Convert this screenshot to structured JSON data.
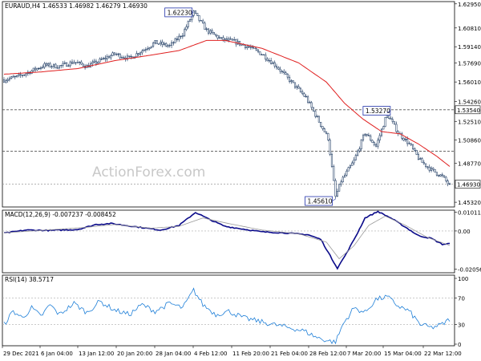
{
  "chart_data": [
    {
      "type": "candlestick",
      "title": "EURAUD,H4",
      "ohlc_label": "1.46533 1.46982 1.46279 1.46930",
      "last_price": "1.46930",
      "watermark": "ActionForex.com",
      "ylim": [
        1.449,
        1.6315
      ],
      "yticks": [
        "1.62950",
        "1.60810",
        "1.59140",
        "1.57690",
        "1.56010",
        "1.54260",
        "1.53540",
        "1.52510",
        "1.50860",
        "1.48770",
        "1.46930",
        "1.45320"
      ],
      "h_levels": [
        "1.53540",
        "1.49860"
      ],
      "annotations": [
        {
          "label": "1.62230",
          "price": 1.6223
        },
        {
          "label": "1.53270",
          "price": 1.5327
        },
        {
          "label": "1.45610",
          "price": 1.4561
        }
      ],
      "close_anchors": [
        [
          0,
          1.562
        ],
        [
          8,
          1.565
        ],
        [
          15,
          1.57
        ],
        [
          22,
          1.575
        ],
        [
          30,
          1.574
        ],
        [
          38,
          1.578
        ],
        [
          45,
          1.574
        ],
        [
          52,
          1.579
        ],
        [
          60,
          1.585
        ],
        [
          68,
          1.581
        ],
        [
          75,
          1.588
        ],
        [
          82,
          1.595
        ],
        [
          90,
          1.592
        ],
        [
          97,
          1.603
        ],
        [
          103,
          1.622
        ],
        [
          110,
          1.606
        ],
        [
          118,
          1.598
        ],
        [
          125,
          1.596
        ],
        [
          133,
          1.591
        ],
        [
          140,
          1.585
        ],
        [
          148,
          1.574
        ],
        [
          156,
          1.56
        ],
        [
          164,
          1.546
        ],
        [
          170,
          1.528
        ],
        [
          176,
          1.51
        ],
        [
          180,
          1.458
        ],
        [
          183,
          1.472
        ],
        [
          190,
          1.49
        ],
        [
          196,
          1.515
        ],
        [
          202,
          1.503
        ],
        [
          208,
          1.532
        ],
        [
          214,
          1.515
        ],
        [
          220,
          1.505
        ],
        [
          226,
          1.49
        ],
        [
          232,
          1.482
        ],
        [
          238,
          1.476
        ],
        [
          242,
          1.468
        ]
      ],
      "ma_anchors": [
        [
          0,
          1.567
        ],
        [
          20,
          1.569
        ],
        [
          40,
          1.572
        ],
        [
          60,
          1.579
        ],
        [
          80,
          1.584
        ],
        [
          95,
          1.588
        ],
        [
          110,
          1.597
        ],
        [
          120,
          1.597
        ],
        [
          140,
          1.59
        ],
        [
          160,
          1.577
        ],
        [
          175,
          1.56
        ],
        [
          185,
          1.541
        ],
        [
          195,
          1.527
        ],
        [
          205,
          1.516
        ],
        [
          215,
          1.514
        ],
        [
          225,
          1.505
        ],
        [
          235,
          1.494
        ],
        [
          242,
          1.485
        ]
      ]
    },
    {
      "type": "line",
      "title": "MACD(12,26,9) -0.007237 -0.008452",
      "ylim": [
        -0.0225,
        0.0112
      ],
      "yticks": [
        "0.010113",
        "0.00",
        "-0.020561"
      ],
      "series": [
        {
          "name": "MACD",
          "color": "#0b0b8a",
          "anchors": [
            [
              0,
              -0.0012
            ],
            [
              12,
              0.0005
            ],
            [
              25,
              0.0003
            ],
            [
              40,
              0.0008
            ],
            [
              50,
              0.0035
            ],
            [
              58,
              0.004
            ],
            [
              70,
              0.0025
            ],
            [
              85,
              0.0005
            ],
            [
              95,
              0.003
            ],
            [
              104,
              0.01
            ],
            [
              112,
              0.006
            ],
            [
              120,
              0.0025
            ],
            [
              130,
              0.001
            ],
            [
              140,
              -0.0005
            ],
            [
              152,
              -0.001
            ],
            [
              165,
              -0.002
            ],
            [
              172,
              -0.0045
            ],
            [
              178,
              -0.015
            ],
            [
              181,
              -0.02
            ],
            [
              186,
              -0.012
            ],
            [
              192,
              -0.001
            ],
            [
              196,
              0.007
            ],
            [
              203,
              0.0105
            ],
            [
              210,
              0.007
            ],
            [
              218,
              0.002
            ],
            [
              225,
              -0.0025
            ],
            [
              232,
              -0.004
            ],
            [
              238,
              -0.0072
            ],
            [
              242,
              -0.0068
            ]
          ]
        },
        {
          "name": "Signal",
          "color": "#999999",
          "anchors": [
            [
              0,
              -0.001
            ],
            [
              20,
              0.0003
            ],
            [
              45,
              0.002
            ],
            [
              60,
              0.0035
            ],
            [
              80,
              0.0015
            ],
            [
              95,
              0.0025
            ],
            [
              108,
              0.007
            ],
            [
              122,
              0.004
            ],
            [
              140,
              0.0005
            ],
            [
              160,
              -0.0015
            ],
            [
              175,
              -0.006
            ],
            [
              182,
              -0.015
            ],
            [
              190,
              -0.008
            ],
            [
              198,
              0.003
            ],
            [
              207,
              0.008
            ],
            [
              218,
              0.003
            ],
            [
              230,
              -0.0035
            ],
            [
              242,
              -0.0078
            ]
          ]
        }
      ]
    },
    {
      "type": "line",
      "title": "RSI(14) 38.5717",
      "ylim": [
        0,
        100
      ],
      "yticks": [
        "100",
        "70",
        "30",
        "0"
      ],
      "levels": [
        70,
        30
      ],
      "series": [
        {
          "name": "RSI",
          "color": "#1e7fd8",
          "anchors": [
            [
              0,
              30
            ],
            [
              5,
              50
            ],
            [
              10,
              40
            ],
            [
              15,
              55
            ],
            [
              20,
              42
            ],
            [
              25,
              60
            ],
            [
              30,
              45
            ],
            [
              38,
              62
            ],
            [
              45,
              48
            ],
            [
              52,
              65
            ],
            [
              60,
              52
            ],
            [
              68,
              45
            ],
            [
              75,
              60
            ],
            [
              82,
              50
            ],
            [
              90,
              62
            ],
            [
              97,
              55
            ],
            [
              103,
              82
            ],
            [
              108,
              60
            ],
            [
              115,
              45
            ],
            [
              122,
              50
            ],
            [
              130,
              40
            ],
            [
              138,
              35
            ],
            [
              146,
              30
            ],
            [
              155,
              25
            ],
            [
              163,
              20
            ],
            [
              170,
              10
            ],
            [
              176,
              5
            ],
            [
              180,
              3
            ],
            [
              184,
              30
            ],
            [
              190,
              55
            ],
            [
              196,
              48
            ],
            [
              202,
              68
            ],
            [
              208,
              72
            ],
            [
              214,
              58
            ],
            [
              220,
              50
            ],
            [
              226,
              30
            ],
            [
              232,
              25
            ],
            [
              238,
              30
            ],
            [
              242,
              38
            ]
          ]
        }
      ]
    }
  ],
  "x_axis": {
    "count": 243,
    "labels": [
      {
        "text": "29 Dec 2021",
        "i": 0
      },
      {
        "text": "6 Jan 04:00",
        "i": 25
      },
      {
        "text": "13 Jan 12:00",
        "i": 51
      },
      {
        "text": "20 Jan 20:00",
        "i": 77
      },
      {
        "text": "28 Jan 04:00",
        "i": 102
      },
      {
        "text": "4 Feb 12:00",
        "i": 128
      },
      {
        "text": "11 Feb 20:00",
        "i": 154
      },
      {
        "text": "21 Feb 04:00",
        "i": 178
      },
      {
        "text": "28 Feb 12:00",
        "i": 201
      },
      {
        "text": "7 Mar 20:00",
        "i": 224
      },
      {
        "text": "15 Mar 04:00",
        "i": 242
      },
      {
        "text": "22 Mar 12:00",
        "i": 242
      }
    ]
  }
}
